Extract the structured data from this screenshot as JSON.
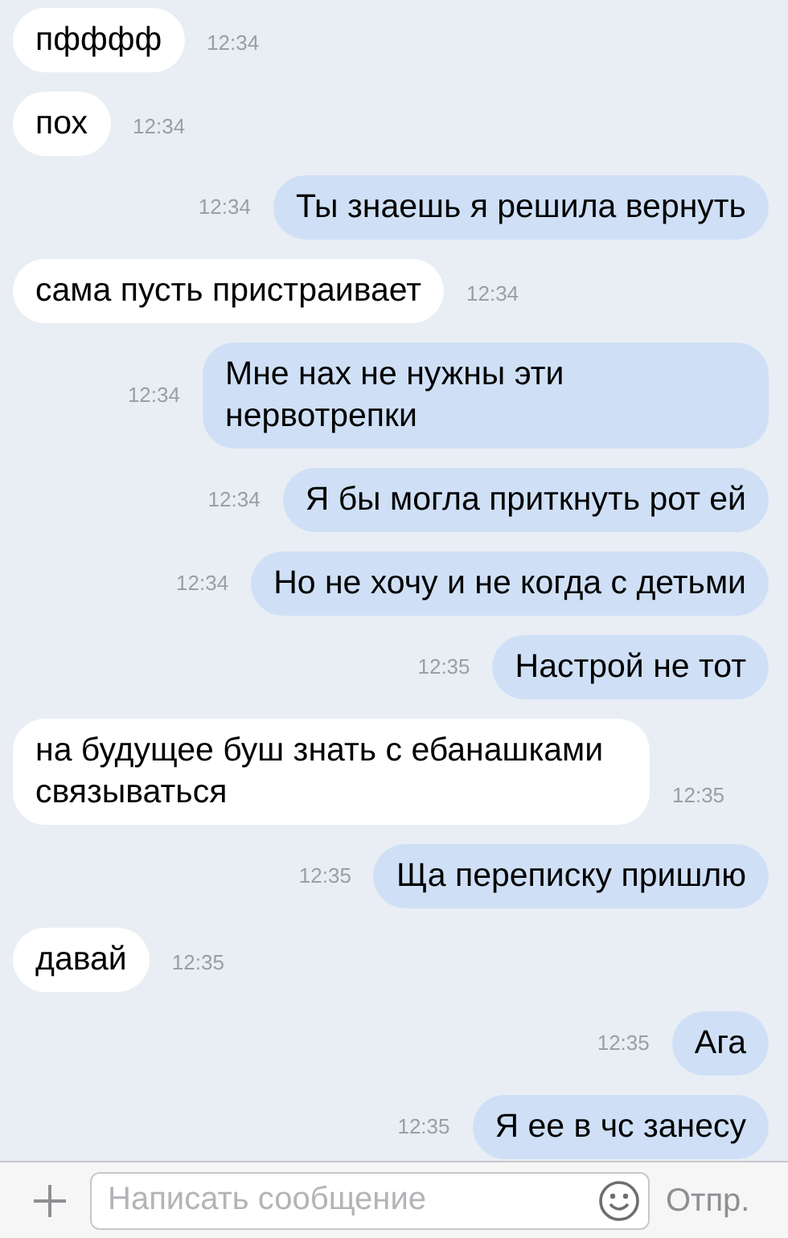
{
  "messages": [
    {
      "kind": "incoming",
      "text": "пфффф",
      "time": "12:34"
    },
    {
      "kind": "incoming",
      "text": "пох",
      "time": "12:34"
    },
    {
      "kind": "outgoing",
      "text": "Ты знаешь я решила вернуть",
      "time": "12:34"
    },
    {
      "kind": "incoming",
      "text": "сама пусть пристраивает",
      "time": "12:34"
    },
    {
      "kind": "outgoing",
      "text": "Мне нах не нужны эти нервотрепки",
      "time": "12:34"
    },
    {
      "kind": "outgoing",
      "text": "Я бы могла приткнуть рот ей",
      "time": "12:34"
    },
    {
      "kind": "outgoing",
      "text": "Но не хочу и не когда с детьми",
      "time": "12:34"
    },
    {
      "kind": "outgoing",
      "text": "Настрой не тот",
      "time": "12:35"
    },
    {
      "kind": "incoming",
      "text": "на будущее буш знать с ебанашками связываться",
      "time": "12:35"
    },
    {
      "kind": "outgoing",
      "text": "Ща переписку пришлю",
      "time": "12:35"
    },
    {
      "kind": "incoming",
      "text": "давай",
      "time": "12:35"
    },
    {
      "kind": "outgoing",
      "text": "Ага",
      "time": "12:35"
    },
    {
      "kind": "outgoing",
      "text": "Я ее в чс занесу",
      "time": "12:35"
    }
  ],
  "composer": {
    "placeholder": "Написать сообщение",
    "send": "Отпр."
  }
}
